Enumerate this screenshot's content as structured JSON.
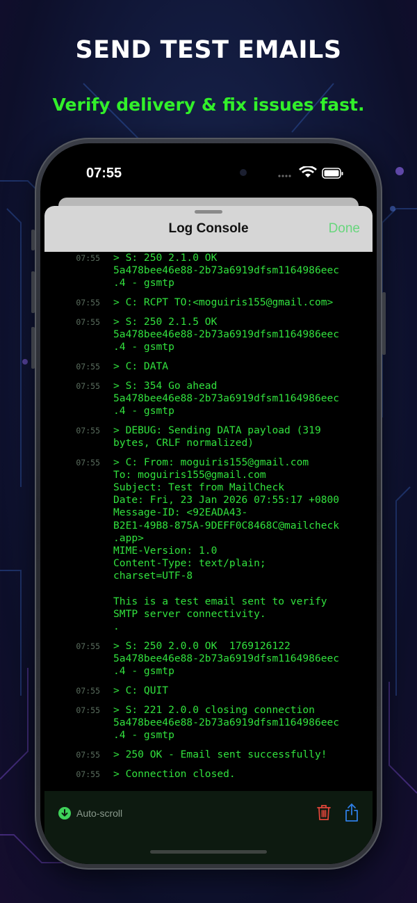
{
  "promo": {
    "headline": "SEND TEST EMAILS",
    "subheadline": "Verify delivery & fix issues fast."
  },
  "status_bar": {
    "time": "07:55"
  },
  "sheet": {
    "title": "Log Console",
    "done_label": "Done"
  },
  "log": [
    {
      "time": "07:55",
      "message": "> S: 250 2.1.0 OK\n5a478bee46e88-2b73a6919dfsm1164986eec\n.4 - gsmtp"
    },
    {
      "time": "07:55",
      "message": "> C: RCPT TO:<moguiris155@gmail.com>"
    },
    {
      "time": "07:55",
      "message": "> S: 250 2.1.5 OK\n5a478bee46e88-2b73a6919dfsm1164986eec\n.4 - gsmtp"
    },
    {
      "time": "07:55",
      "message": "> C: DATA"
    },
    {
      "time": "07:55",
      "message": "> S: 354 Go ahead\n5a478bee46e88-2b73a6919dfsm1164986eec\n.4 - gsmtp"
    },
    {
      "time": "07:55",
      "message": "> DEBUG: Sending DATA payload (319\nbytes, CRLF normalized)"
    },
    {
      "time": "07:55",
      "message": "> C: From: moguiris155@gmail.com\nTo: moguiris155@gmail.com\nSubject: Test from MailCheck\nDate: Fri, 23 Jan 2026 07:55:17 +0800\nMessage-ID: <92EADA43-\nB2E1-49B8-875A-9DEFF0C8468C@mailcheck\n.app>\nMIME-Version: 1.0\nContent-Type: text/plain;\ncharset=UTF-8\n\nThis is a test email sent to verify\nSMTP server connectivity.\n."
    },
    {
      "time": "07:55",
      "message": "> S: 250 2.0.0 OK  1769126122\n5a478bee46e88-2b73a6919dfsm1164986eec\n.4 - gsmtp"
    },
    {
      "time": "07:55",
      "message": "> C: QUIT"
    },
    {
      "time": "07:55",
      "message": "> S: 221 2.0.0 closing connection\n5a478bee46e88-2b73a6919dfsm1164986eec\n.4 - gsmtp"
    },
    {
      "time": "07:55",
      "message": "> 250 OK - Email sent successfully!"
    },
    {
      "time": "07:55",
      "message": "> Connection closed."
    }
  ],
  "bottom_bar": {
    "autoscroll_label": "Auto-scroll",
    "icons": {
      "autoscroll": "arrow-down-circle-icon",
      "delete": "trash-icon",
      "share": "share-icon"
    }
  },
  "colors": {
    "headline": "#ffffff",
    "subheadline": "#32f02a",
    "log_text": "#32e23e",
    "log_timestamp": "#5a6d5e",
    "done": "#67d67c",
    "autoscroll_icon": "#3fd25a",
    "trash": "#e0453a",
    "share": "#2f7fe6",
    "bottom_bar": "#0d1a10"
  }
}
